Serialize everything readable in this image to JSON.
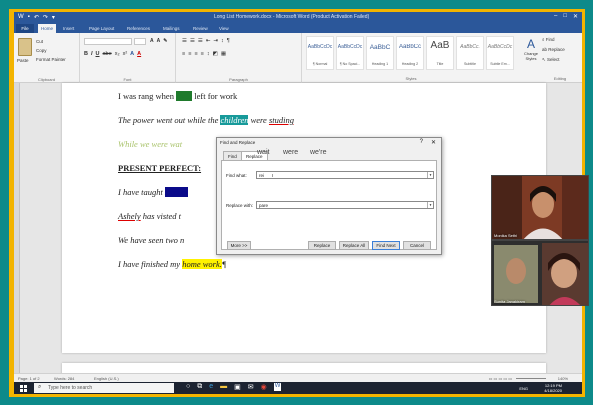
{
  "window": {
    "title": "Long List Homework.docx - Microsoft Word (Product Activation Failed)",
    "controls": [
      "–",
      "□",
      "✕"
    ]
  },
  "ribbon_tabs": [
    "File",
    "Home",
    "Insert",
    "Page Layout",
    "References",
    "Mailings",
    "Review",
    "View"
  ],
  "ribbon": {
    "clipboard": {
      "paste": "Paste",
      "cut": "Cut",
      "copy": "Copy",
      "format_painter": "Format Painter",
      "label": "Clipboard"
    },
    "font": {
      "label": "Font",
      "format_buttons": [
        "B",
        "I",
        "U",
        "abe",
        "x₂",
        "x²",
        "A",
        "A"
      ]
    },
    "paragraph": {
      "label": "Paragraph"
    },
    "styles": {
      "label": "Styles",
      "items": [
        {
          "sample": "AaBbCcDc",
          "name": "¶ Normal"
        },
        {
          "sample": "AaBbCcDc",
          "name": "¶ No Spaci..."
        },
        {
          "sample": "AaBbC",
          "name": "Heading 1"
        },
        {
          "sample": "AaBbCc",
          "name": "Heading 2"
        },
        {
          "sample": "AaB",
          "name": "Title"
        },
        {
          "sample": "AaBbCc.",
          "name": "Subtitle"
        },
        {
          "sample": "AaBbCcDc",
          "name": "Subtle Em..."
        }
      ],
      "change_styles": "Change Styles"
    },
    "editing": {
      "label": "Editing",
      "find": "Find",
      "replace": "Replace",
      "select": "Select"
    }
  },
  "document": {
    "lines": [
      {
        "pre": "I was rang when ",
        "highlight": "Iwas",
        "post": " left for work"
      },
      {
        "pre": "The power went out while the ",
        "highlight": "children",
        "post": " were ",
        "underline": "studing"
      },
      {
        "text": "While we were wat"
      },
      {
        "text": "PRESENT PERFECT:"
      },
      {
        "pre": "I have taught ",
        "highlight": "xxxxxx"
      },
      {
        "pre": "Ashely",
        "post": " has visted t"
      },
      {
        "text": "We have seen two n"
      },
      {
        "pre": "I have finished my ",
        "highlight": "home work.",
        "post": "¶"
      }
    ]
  },
  "dialog": {
    "title": "Find and Replace",
    "help": "?",
    "close": "✕",
    "tabs": [
      "Find",
      "Replace"
    ],
    "find_label": "Find what:",
    "find_value": "rei",
    "replace_label": "Replace with:",
    "replace_value": "pare",
    "buttons": {
      "more": "More >>",
      "replace": "Replace",
      "replace_all": "Replace All",
      "find_next": "Find Next",
      "cancel": "Cancel"
    }
  },
  "overlay_words": [
    "wait",
    "were",
    "we're"
  ],
  "status_bar": {
    "page": "Page: 1 of 2",
    "words": "Words: 284",
    "language": "English (U.S.)",
    "zoom": "140%"
  },
  "taskbar": {
    "search_placeholder": "Type here to search",
    "lang": "ENG",
    "time": "12:19 PM",
    "date": "4/18/2020"
  },
  "video_tiles": [
    {
      "name": "Monika Sethi"
    },
    {
      "name": "Sunita Janakiram"
    }
  ]
}
